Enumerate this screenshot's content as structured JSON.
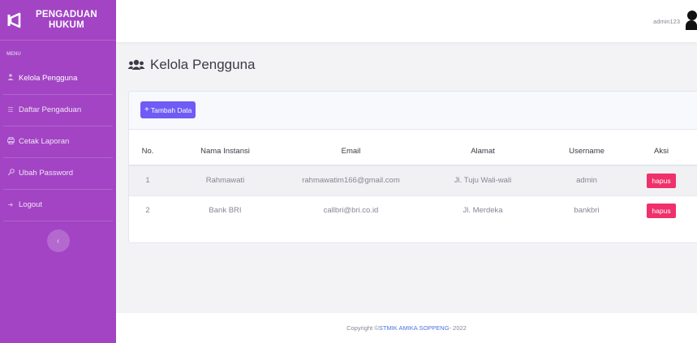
{
  "brand": {
    "line1": "PENGADUAN",
    "line2": "HUKUM",
    "icon": "megaphone-icon"
  },
  "sidebar": {
    "heading": "MENU",
    "items": [
      {
        "label": "Kelola Pengguna",
        "icon": "users-icon",
        "active": true
      },
      {
        "label": "Daftar Pengaduan",
        "icon": "list-icon",
        "active": false
      },
      {
        "label": "Cetak Laporan",
        "icon": "print-icon",
        "active": false
      },
      {
        "label": "Ubah Password",
        "icon": "key-icon",
        "active": false
      },
      {
        "label": "Logout",
        "icon": "logout-icon",
        "active": false
      }
    ],
    "toggle_icon": "chevron-left-icon"
  },
  "topbar": {
    "username": "admin123",
    "avatar_icon": "user-icon"
  },
  "page": {
    "title": "Kelola Pengguna",
    "title_icon": "users-icon"
  },
  "card": {
    "add_button": "Tambah Data"
  },
  "table": {
    "headers": [
      "No.",
      "Nama Instansi",
      "Email",
      "Alamat",
      "Username",
      "Aksi"
    ],
    "rows": [
      {
        "no": "1",
        "nama": "Rahmawati",
        "email": "rahmawatim166@gmail.com",
        "alamat": "Jl. Tuju Wali-wali",
        "username": "admin",
        "aksi": "hapus"
      },
      {
        "no": "2",
        "nama": "Bank BRI",
        "email": "callbri@bri.co.id",
        "alamat": "Jl. Merdeka",
        "username": "bankbri",
        "aksi": "hapus"
      }
    ]
  },
  "footer": {
    "prefix": "Copyright © ",
    "link": "STMIK AMIKA SOPPENG",
    "suffix": " - 2022"
  },
  "colors": {
    "sidebar": "#a244c4",
    "primary_button": "#6f5cf5",
    "danger_button": "#f0306a",
    "link": "#4e73df"
  }
}
